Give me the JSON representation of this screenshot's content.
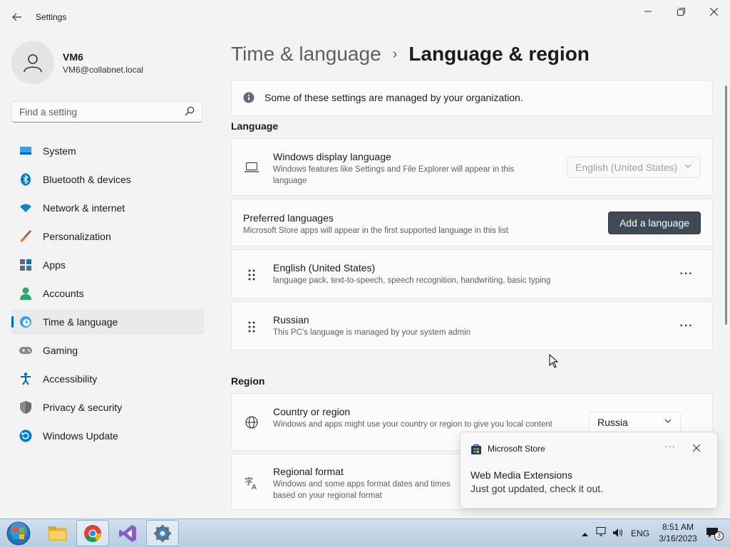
{
  "window": {
    "title": "Settings",
    "back_icon": "arrow-left-icon"
  },
  "profile": {
    "name": "VM6",
    "email": "VM6@collabnet.local"
  },
  "search": {
    "placeholder": "Find a setting"
  },
  "sidebar": {
    "items": [
      {
        "label": "System",
        "icon": "system-monitor-icon",
        "color": "#0078d4"
      },
      {
        "label": "Bluetooth & devices",
        "icon": "bluetooth-icon",
        "color": "#0078d4"
      },
      {
        "label": "Network & internet",
        "icon": "wifi-icon",
        "color": "#0a82d8"
      },
      {
        "label": "Personalization",
        "icon": "paintbrush-icon",
        "color": "#e0803a"
      },
      {
        "label": "Apps",
        "icon": "apps-grid-icon",
        "color": "#5a6c7e"
      },
      {
        "label": "Accounts",
        "icon": "person-icon",
        "color": "#2ea56f"
      },
      {
        "label": "Time & language",
        "icon": "clock-globe-icon",
        "color": "#0078d4",
        "active": true
      },
      {
        "label": "Gaming",
        "icon": "gamepad-icon",
        "color": "#6b6b6b"
      },
      {
        "label": "Accessibility",
        "icon": "accessibility-icon",
        "color": "#0067c0"
      },
      {
        "label": "Privacy & security",
        "icon": "shield-icon",
        "color": "#7a7a7a"
      },
      {
        "label": "Windows Update",
        "icon": "update-icon",
        "color": "#0078d4"
      }
    ]
  },
  "breadcrumb": {
    "parent": "Time & language",
    "separator": "›",
    "current": "Language & region"
  },
  "info_banner": {
    "text": "Some of these settings are managed by your organization."
  },
  "language_section": {
    "heading": "Language",
    "display_language": {
      "title": "Windows display language",
      "description": "Windows features like Settings and File Explorer will appear in this language",
      "value": "English (United States)",
      "disabled": true
    },
    "preferred": {
      "title": "Preferred languages",
      "description": "Microsoft Store apps will appear in the first supported language in this list",
      "add_button": "Add a language"
    },
    "languages": [
      {
        "name": "English (United States)",
        "details": "language pack, text-to-speech, speech recognition, handwriting, basic typing",
        "more": "···"
      },
      {
        "name": "Russian",
        "details": "This PC's language is managed by your system admin",
        "more": "···"
      }
    ]
  },
  "region_section": {
    "heading": "Region",
    "country": {
      "title": "Country or region",
      "description": "Windows and apps might use your country or region to give you local content",
      "value": "Russia"
    },
    "format": {
      "title": "Regional format",
      "description": "Windows and some apps format dates and times based on your regional format"
    }
  },
  "toast": {
    "app": "Microsoft Store",
    "more": "···",
    "title": "Web Media Extensions",
    "body": "Just got updated, check it out."
  },
  "taskbar": {
    "apps": [
      "file-explorer-icon",
      "chrome-icon",
      "visual-studio-icon",
      "settings-gear-icon"
    ],
    "language": "ENG",
    "time": "8:51 AM",
    "date": "3/16/2023",
    "notification_count": "3"
  }
}
